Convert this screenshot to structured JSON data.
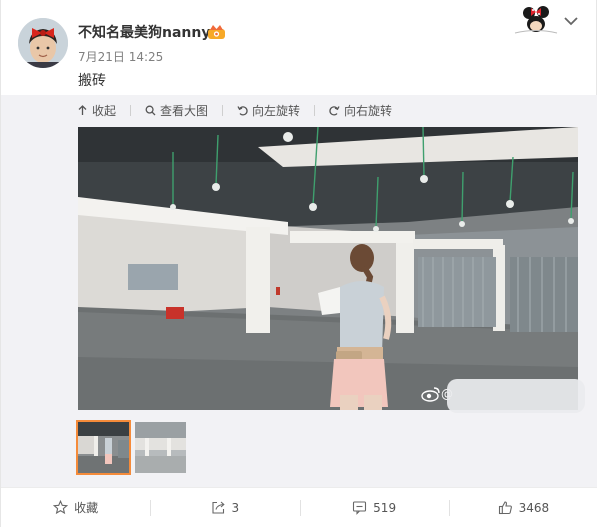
{
  "post": {
    "username": "不知名最美狗nanny",
    "time": "7月21日 14:25",
    "text": "搬砖",
    "vip_icon": "vip-crown-badge",
    "sticker_icon": "minnie-mouse-sticker"
  },
  "media_toolbar": {
    "collapse_label": "收起",
    "view_large_label": "查看大图",
    "rotate_left_label": "向左旋转",
    "rotate_right_label": "向右旋转"
  },
  "media": {
    "watermark_symbol": "@",
    "thumbnails": [
      {
        "selected": true
      },
      {
        "selected": false
      }
    ]
  },
  "actions": {
    "favorite_label": "收藏",
    "repost_count": "3",
    "comment_count": "519",
    "like_count": "3468"
  },
  "colors": {
    "accent": "#f58b3a",
    "text_secondary": "#808080"
  }
}
